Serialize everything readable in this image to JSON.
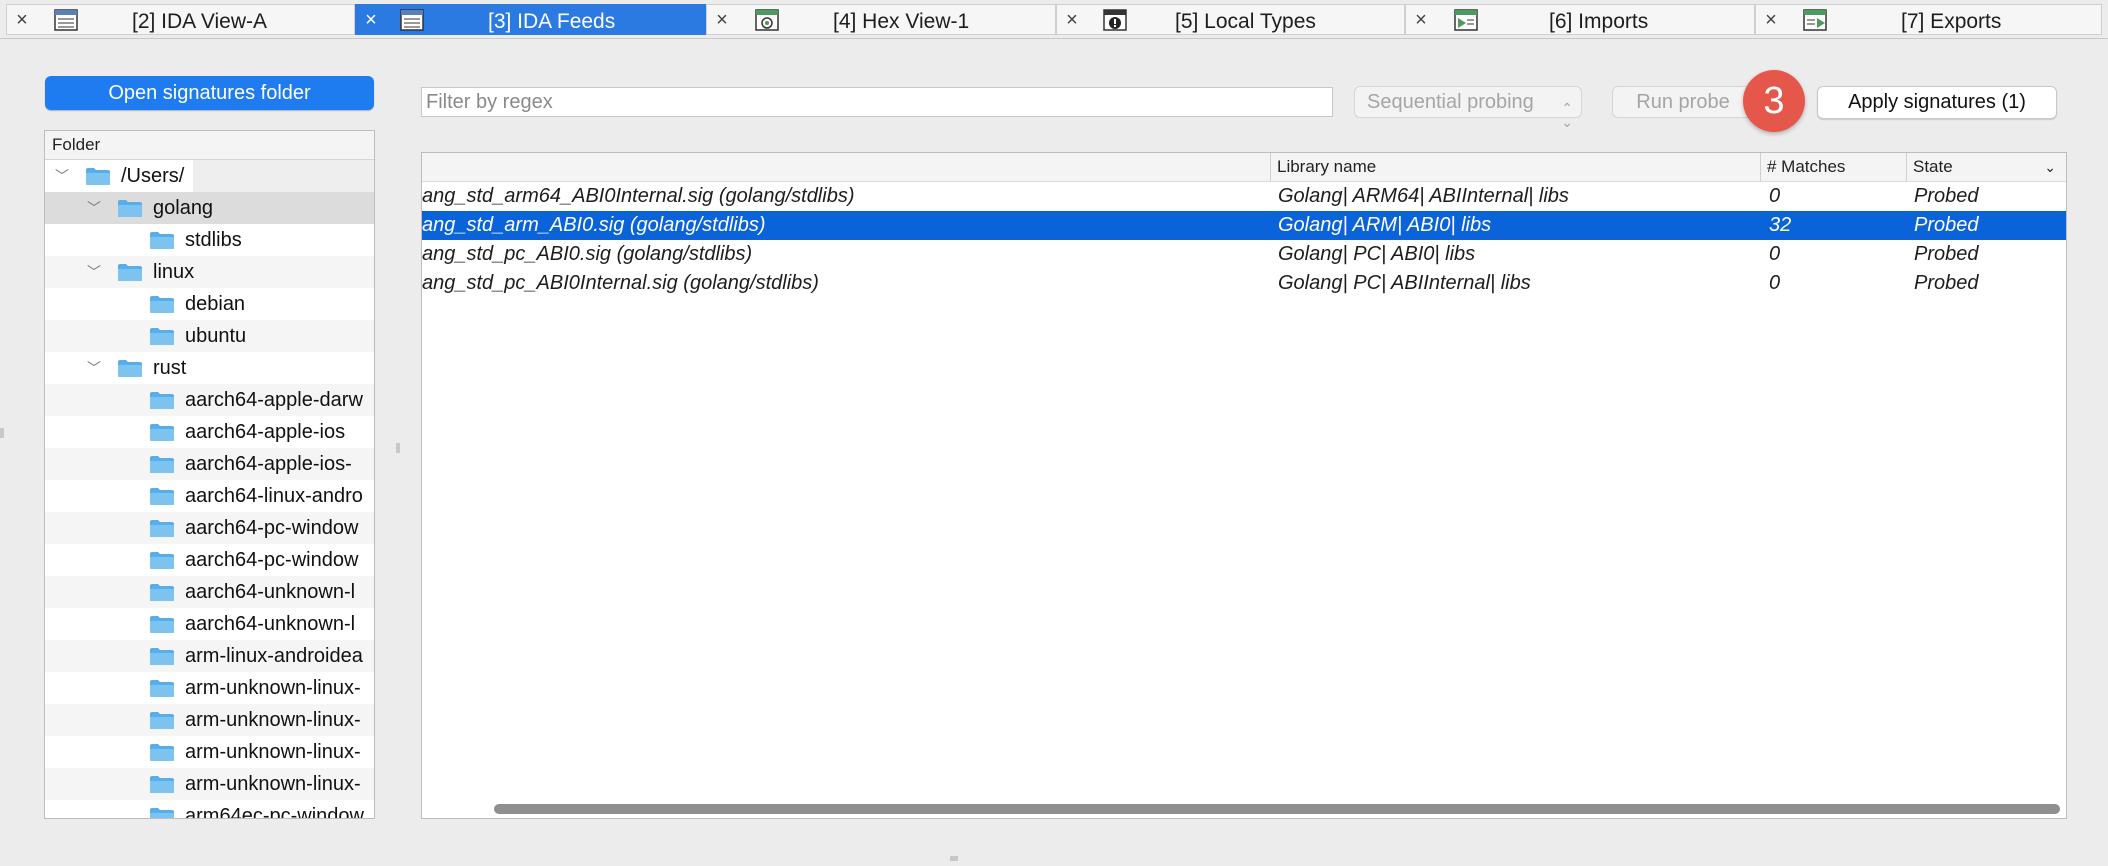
{
  "tabs": [
    {
      "label": "[2] IDA View-A",
      "icon": "ida-view-icon",
      "active": false
    },
    {
      "label": "[3] IDA Feeds",
      "icon": "feeds-icon",
      "active": true
    },
    {
      "label": "[4] Hex View-1",
      "icon": "hex-view-icon",
      "active": false
    },
    {
      "label": "[5] Local Types",
      "icon": "local-types-icon",
      "active": false
    },
    {
      "label": "[6] Imports",
      "icon": "imports-icon",
      "active": false
    },
    {
      "label": "[7] Exports",
      "icon": "exports-icon",
      "active": false
    }
  ],
  "left": {
    "open_button": "Open signatures folder",
    "tree_header": "Folder",
    "items": [
      {
        "label": "/Users/",
        "level": 0,
        "expanded": true
      },
      {
        "label": "golang",
        "level": 1,
        "expanded": true,
        "selected": true
      },
      {
        "label": "stdlibs",
        "level": 2
      },
      {
        "label": "linux",
        "level": 1,
        "expanded": true
      },
      {
        "label": "debian",
        "level": 2
      },
      {
        "label": "ubuntu",
        "level": 2
      },
      {
        "label": "rust",
        "level": 1,
        "expanded": true
      },
      {
        "label": "aarch64-apple-darw",
        "level": 2
      },
      {
        "label": "aarch64-apple-ios",
        "level": 2
      },
      {
        "label": "aarch64-apple-ios-",
        "level": 2
      },
      {
        "label": "aarch64-linux-andro",
        "level": 2
      },
      {
        "label": "aarch64-pc-window",
        "level": 2
      },
      {
        "label": "aarch64-pc-window",
        "level": 2
      },
      {
        "label": "aarch64-unknown-l",
        "level": 2
      },
      {
        "label": "aarch64-unknown-l",
        "level": 2
      },
      {
        "label": "arm-linux-androidea",
        "level": 2
      },
      {
        "label": "arm-unknown-linux-",
        "level": 2
      },
      {
        "label": "arm-unknown-linux-",
        "level": 2
      },
      {
        "label": "arm-unknown-linux-",
        "level": 2
      },
      {
        "label": "arm-unknown-linux-",
        "level": 2
      },
      {
        "label": "arm64ec-pc-window",
        "level": 2
      }
    ]
  },
  "toolbar": {
    "filter_placeholder": "Filter by regex",
    "probe_mode": "Sequential probing",
    "run_probe": "Run probe",
    "apply": "Apply signatures (1)",
    "step_badge": "3"
  },
  "table": {
    "columns": [
      "",
      "Library name",
      "# Matches",
      "State"
    ],
    "rows": [
      {
        "file": "ang_std_arm64_ABI0Internal.sig (golang/stdlibs)",
        "library": "Golang| ARM64| ABIInternal| libs",
        "matches": "0",
        "state": "Probed",
        "selected": false
      },
      {
        "file": "ang_std_arm_ABI0.sig (golang/stdlibs)",
        "library": "Golang| ARM| ABI0| libs",
        "matches": "32",
        "state": "Probed",
        "selected": true
      },
      {
        "file": "ang_std_pc_ABI0.sig (golang/stdlibs)",
        "library": "Golang| PC| ABI0| libs",
        "matches": "0",
        "state": "Probed",
        "selected": false
      },
      {
        "file": "ang_std_pc_ABI0Internal.sig (golang/stdlibs)",
        "library": "Golang| PC| ABIInternal| libs",
        "matches": "0",
        "state": "Probed",
        "selected": false
      }
    ]
  },
  "colors": {
    "accent": "#1f7bf0",
    "selection": "#0b63d9",
    "badge": "#e5574a"
  }
}
